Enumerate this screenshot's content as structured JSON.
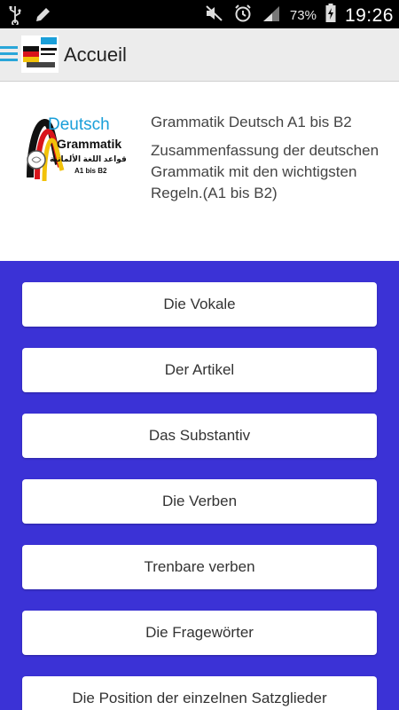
{
  "status_bar": {
    "battery_percent": "73%",
    "time": "19:26",
    "icons": [
      "usb-icon",
      "pencil-icon",
      "mute-icon",
      "alarm-icon",
      "signal-icon",
      "battery-charging-icon"
    ]
  },
  "action_bar": {
    "title": "Accueil",
    "menu_icon": "hamburger-menu-icon"
  },
  "app_info": {
    "logo_deutsch": "Deutsch",
    "logo_grammatik": "Grammatik",
    "logo_arabic": "قواعد اللغة الألمانية",
    "logo_level": "A1 bis B2",
    "title": "Grammatik Deutsch A1 bis B2",
    "description": "Zusammenfassung der deutschen Grammatik mit den wichtigsten Regeln.(A1 bis B2)"
  },
  "topics": [
    {
      "label": "Die Vokale"
    },
    {
      "label": "Der Artikel"
    },
    {
      "label": "Das Substantiv"
    },
    {
      "label": "Die Verben"
    },
    {
      "label": "Trenbare verben"
    },
    {
      "label": "Die Fragewörter"
    },
    {
      "label": "Die Position der einzelnen Satzglieder"
    }
  ],
  "colors": {
    "topics_background": "#3b32d6",
    "accent": "#29a6d9",
    "action_bar": "#ececec"
  }
}
